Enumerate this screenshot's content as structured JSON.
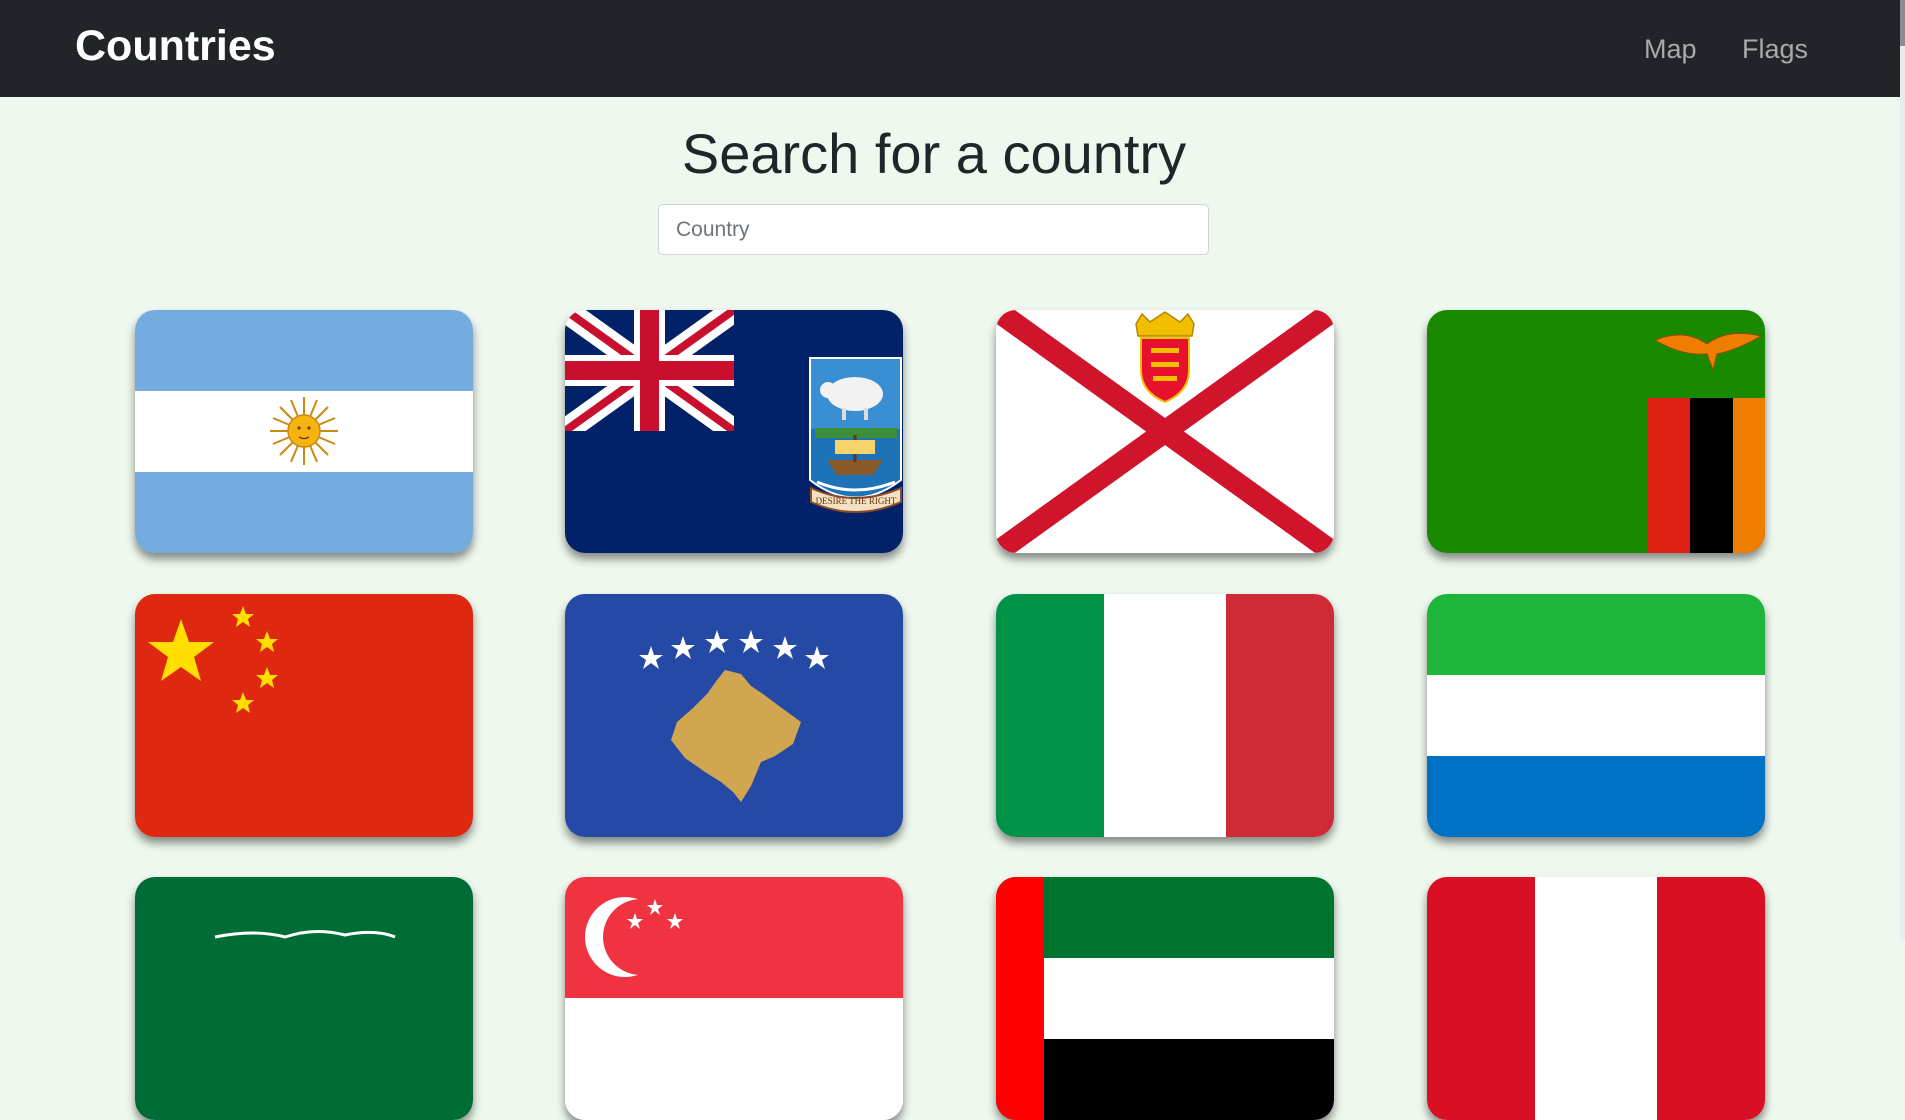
{
  "navbar": {
    "brand": "Countries",
    "links": [
      {
        "label": "Map"
      },
      {
        "label": "Flags"
      }
    ]
  },
  "search": {
    "heading": "Search for a country",
    "placeholder": "Country",
    "value": ""
  },
  "flags": [
    {
      "icon": "argentina-flag-icon"
    },
    {
      "icon": "falkland-islands-flag-icon",
      "motto": "DESIRE THE RIGHT"
    },
    {
      "icon": "jersey-flag-icon"
    },
    {
      "icon": "zambia-flag-icon"
    },
    {
      "icon": "china-flag-icon"
    },
    {
      "icon": "kosovo-flag-icon"
    },
    {
      "icon": "italy-flag-icon"
    },
    {
      "icon": "sierra-leone-flag-icon"
    },
    {
      "icon": "saudi-arabia-flag-icon"
    },
    {
      "icon": "singapore-flag-icon"
    },
    {
      "icon": "uae-flag-icon"
    },
    {
      "icon": "peru-flag-icon"
    }
  ],
  "colors": {
    "navbar": "#212529",
    "page_background": "#eef8ee"
  }
}
